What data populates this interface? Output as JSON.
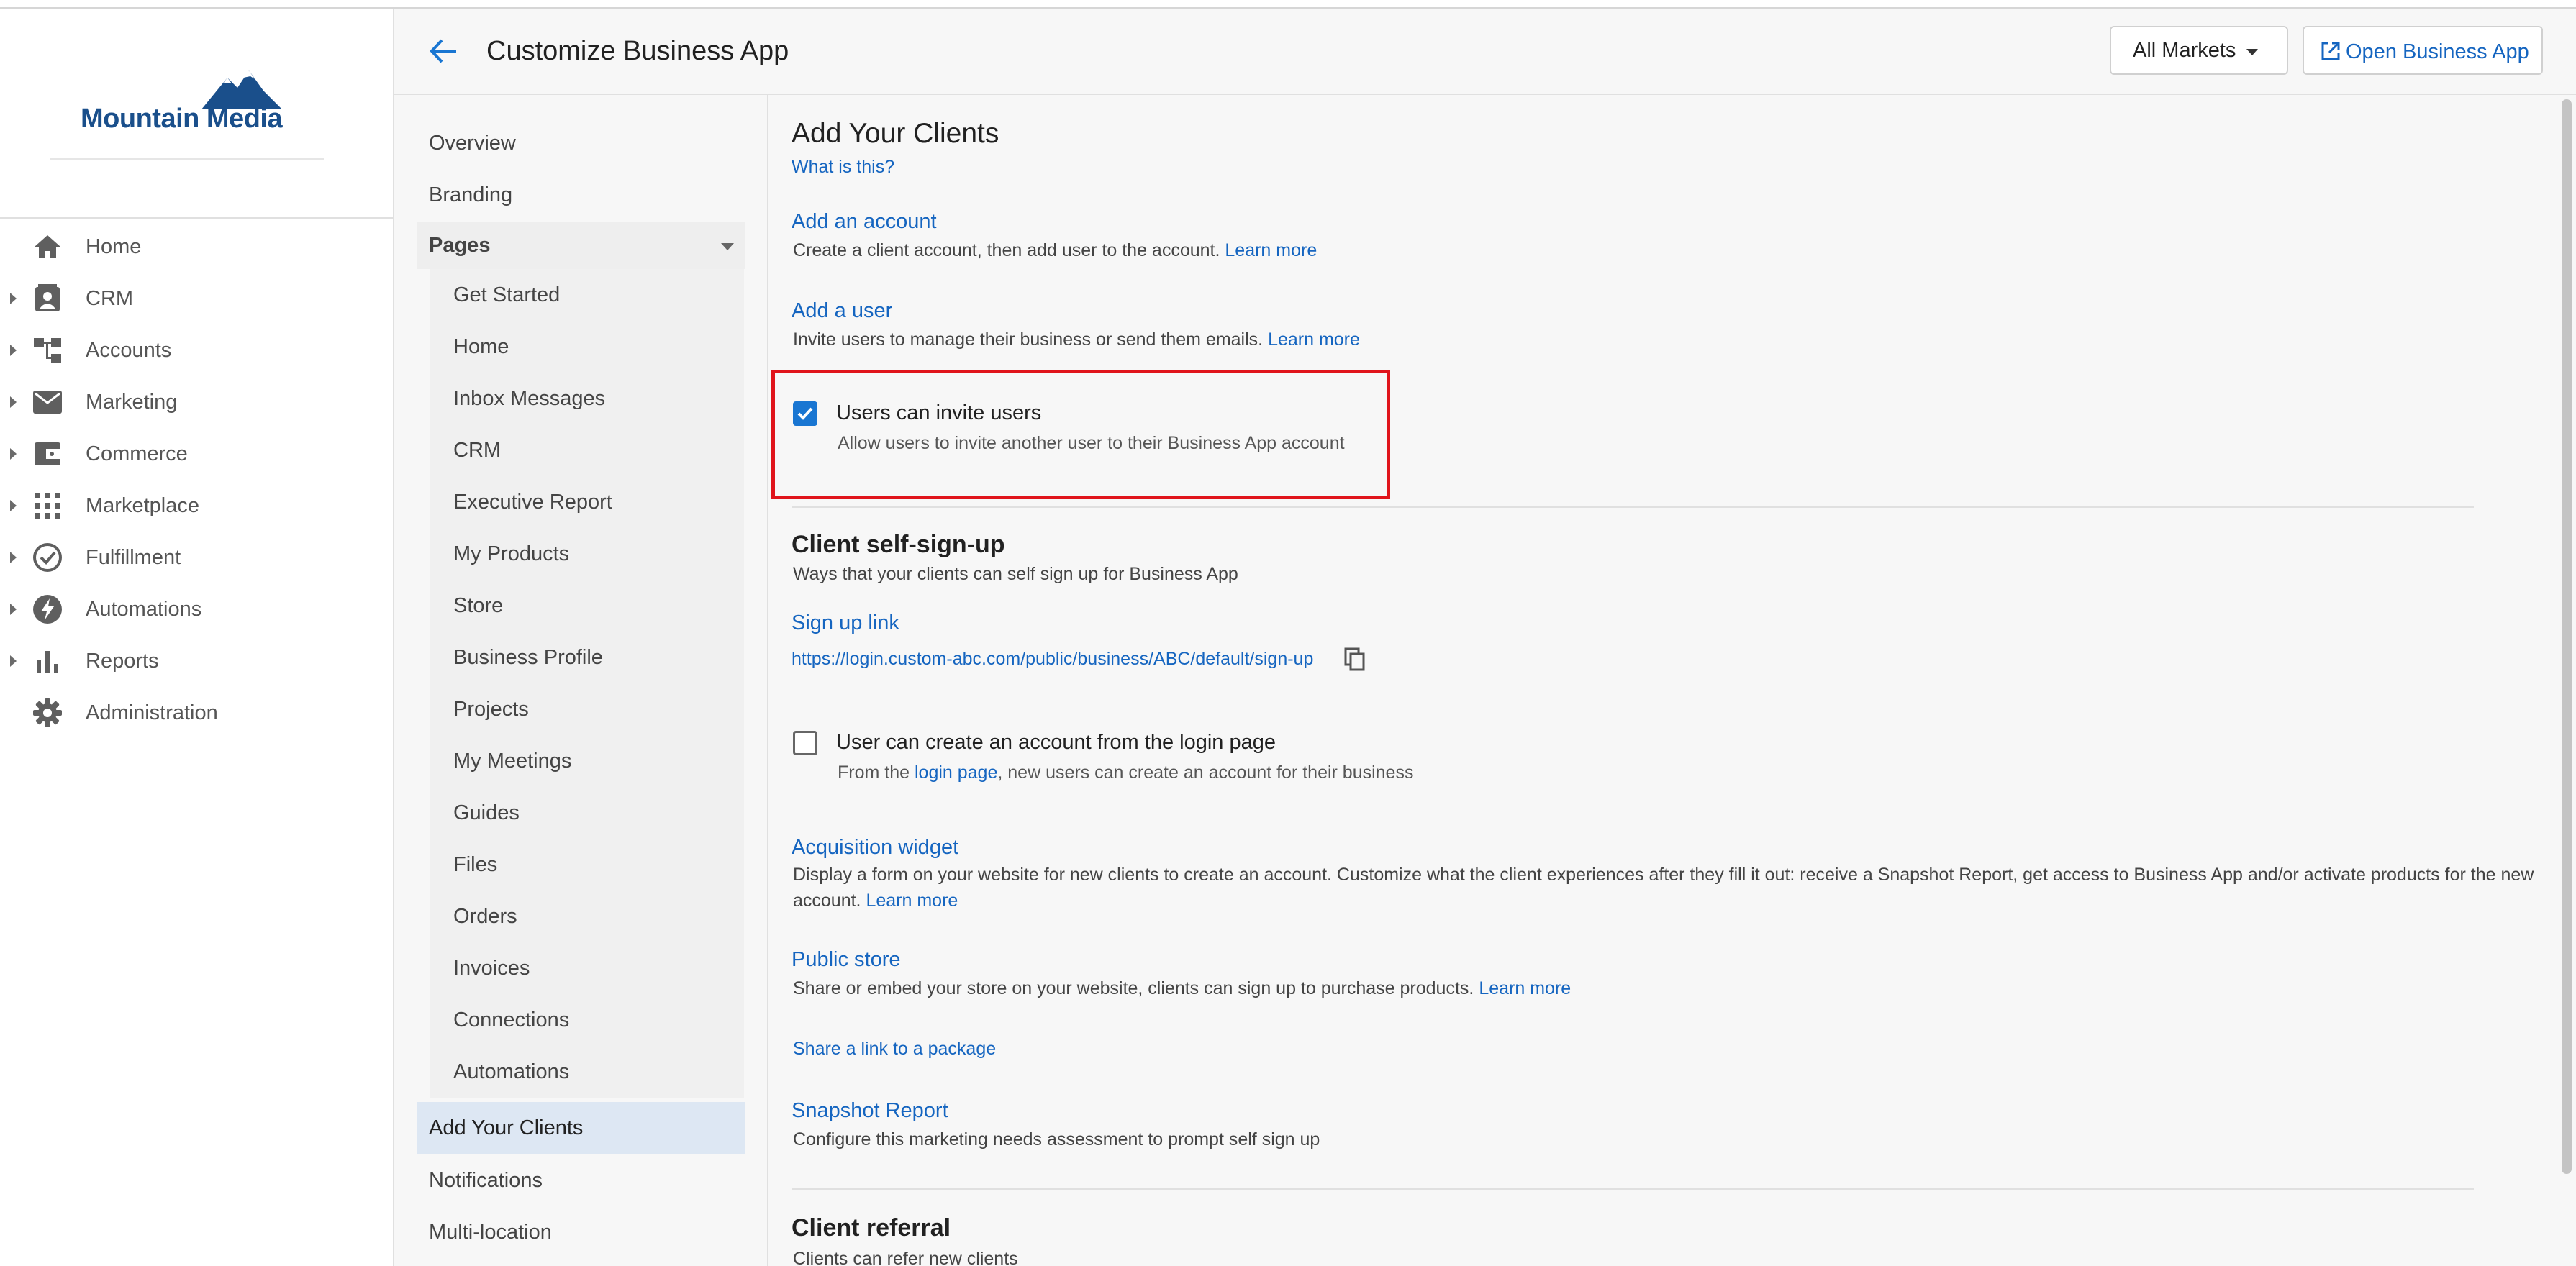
{
  "brand": {
    "name": "Mountain Media"
  },
  "sidebar": {
    "items": [
      {
        "label": "Home",
        "icon": "home-icon",
        "expandable": false
      },
      {
        "label": "CRM",
        "icon": "contact-card-icon",
        "expandable": true
      },
      {
        "label": "Accounts",
        "icon": "hierarchy-icon",
        "expandable": true
      },
      {
        "label": "Marketing",
        "icon": "envelope-icon",
        "expandable": true
      },
      {
        "label": "Commerce",
        "icon": "wallet-icon",
        "expandable": true
      },
      {
        "label": "Marketplace",
        "icon": "grid-icon",
        "expandable": true
      },
      {
        "label": "Fulfillment",
        "icon": "check-circle-icon",
        "expandable": true
      },
      {
        "label": "Automations",
        "icon": "bolt-icon",
        "expandable": true
      },
      {
        "label": "Reports",
        "icon": "bar-chart-icon",
        "expandable": true
      },
      {
        "label": "Administration",
        "icon": "gear-icon",
        "expandable": false
      }
    ]
  },
  "header": {
    "title": "Customize Business App",
    "markets_label": "All Markets",
    "open_label": "Open Business App"
  },
  "submenu": {
    "overview": "Overview",
    "branding": "Branding",
    "pages_label": "Pages",
    "pages": [
      "Get Started",
      "Home",
      "Inbox Messages",
      "CRM",
      "Executive Report",
      "My Products",
      "Store",
      "Business Profile",
      "Projects",
      "My Meetings",
      "Guides",
      "Files",
      "Orders",
      "Invoices",
      "Connections",
      "Automations"
    ],
    "active": "Add Your Clients",
    "notifications": "Notifications",
    "multilocation": "Multi-location"
  },
  "main": {
    "title": "Add Your Clients",
    "what_is_this": "What is this?",
    "add_account": {
      "title": "Add an account",
      "desc": "Create a client account, then add user to the account.",
      "learn_more": "Learn more"
    },
    "add_user": {
      "title": "Add a user",
      "desc": "Invite users to manage their business or send them emails.",
      "learn_more": "Learn more"
    },
    "invite_users": {
      "label": "Users can invite users",
      "desc": "Allow users to invite another user to their Business App account",
      "checked": true
    },
    "self_signup": {
      "title": "Client self-sign-up",
      "desc": "Ways that your clients can self sign up for Business App",
      "signup_link_title": "Sign up link",
      "signup_url": "https://login.custom-abc.com/public/business/ABC/default/sign-up",
      "login_page_option": {
        "label": "User can create an account from the login page",
        "desc_prefix": "From the",
        "desc_link": "login page",
        "desc_suffix": ", new users can create an account for their business",
        "checked": false
      }
    },
    "acquisition": {
      "title": "Acquisition widget",
      "desc": "Display a form on your website for new clients to create an account. Customize what the client experiences after they fill it out: receive a Snapshot Report, get access to Business App and/or activate products for the new account.",
      "learn_more": "Learn more"
    },
    "public_store": {
      "title": "Public store",
      "desc": "Share or embed your store on your website, clients can sign up to purchase products.",
      "learn_more": "Learn more",
      "share_link": "Share a link to a package"
    },
    "snapshot": {
      "title": "Snapshot Report",
      "desc": "Configure this marketing needs assessment to prompt self sign up"
    },
    "referral": {
      "title": "Client referral",
      "desc": "Clients can refer new clients"
    }
  },
  "colors": {
    "accent": "#1976d2",
    "link": "#1565c0",
    "highlight": "#e0141b",
    "active_bg": "#dde7f3"
  }
}
